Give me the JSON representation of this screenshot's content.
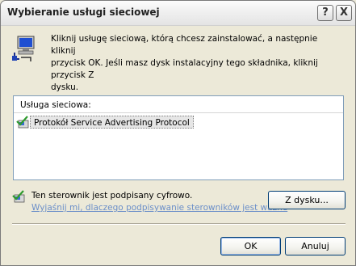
{
  "window": {
    "title": "Wybieranie usługi sieciowej",
    "help_label": "?",
    "close_label": "X"
  },
  "instruction": {
    "line1": "Kliknij usługę sieciową, którą chcesz zainstalować, a następnie kliknij",
    "line2": "przycisk OK. Jeśli masz dysk instalacyjny tego składnika, kliknij przycisk Z",
    "line3": "dysku."
  },
  "service_list": {
    "header": "Usługa sieciowa:",
    "items": [
      {
        "label": "Protokół Service Advertising Protocol",
        "selected": true
      }
    ]
  },
  "signature": {
    "status_text": "Ten sterownik jest podpisany cyfrowo.",
    "link_text": "Wyjaśnij mi, dlaczego podpisywanie sterowników jest ważne"
  },
  "buttons": {
    "have_disk": "Z dysku...",
    "ok": "OK",
    "cancel": "Anuluj"
  },
  "icons": {
    "top_icon": "network-service-icon",
    "item_icon": "certified-driver-icon",
    "signed_icon": "certified-driver-icon"
  },
  "colors": {
    "dialog_bg": "#ece9d8",
    "link": "#6b8fc9",
    "list_border": "#7f9db9"
  }
}
